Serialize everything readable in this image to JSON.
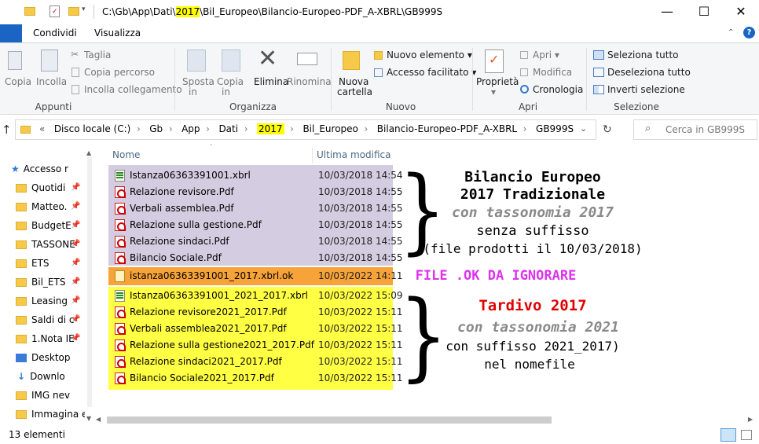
{
  "window": {
    "path_prefix": "C:\\Gb\\App\\Dati\\",
    "path_highlight": "2017",
    "path_suffix": "\\Bil_Europeo\\Bilancio-Europeo-PDF_A-XBRL\\GB999S",
    "minimize": "—",
    "maximize": "☐",
    "close": "✕"
  },
  "menu": {
    "tabs": [
      "Condividi",
      "Visualizza"
    ]
  },
  "ribbon": {
    "appunti": {
      "copia": "Copia",
      "incolla": "Incolla",
      "taglia": "Taglia",
      "copia_percorso": "Copia percorso",
      "incolla_collegamento": "Incolla collegamento",
      "group": "Appunti"
    },
    "organizza": {
      "sposta_1": "Sposta",
      "sposta_2": "in",
      "copia_1": "Copia",
      "copia_2": "in",
      "elimina": "Elimina",
      "rinomina": "Rinomina",
      "group": "Organizza"
    },
    "nuovo": {
      "nuova_1": "Nuova",
      "nuova_2": "cartella",
      "nuovo_elemento": "Nuovo elemento",
      "accesso_facilitato": "Accesso facilitato",
      "group": "Nuovo"
    },
    "apri": {
      "proprieta": "Proprietà",
      "apri": "Apri",
      "modifica": "Modifica",
      "cronologia": "Cronologia",
      "group": "Apri"
    },
    "selezione": {
      "seleziona_tutto": "Seleziona tutto",
      "deseleziona_tutto": "Deseleziona tutto",
      "inverti_selezione": "Inverti selezione",
      "group": "Selezione"
    }
  },
  "address": {
    "crumbs": [
      "Disco locale (C:)",
      "Gb",
      "App",
      "Dati",
      "2017",
      "Bil_Europeo",
      "Bilancio-Europeo-PDF_A-XBRL",
      "GB999S"
    ],
    "search_placeholder": "Cerca in GB999S"
  },
  "nav": {
    "items": [
      "Accesso r",
      "Quotidi",
      "Matteo.",
      "BudgetE",
      "TASSONE",
      "ETS",
      "Bil_ETS",
      "Leasing",
      "Saldi di c",
      "1.Nota IE",
      "Desktop",
      "Downlo",
      "IMG nev",
      "Immagina e"
    ]
  },
  "columns": {
    "name": "Nome",
    "modified": "Ultima modifica"
  },
  "files": [
    {
      "name": "Istanza06363391001.xbrl",
      "date": "10/03/2018 14:54",
      "type": "xbrl"
    },
    {
      "name": "Relazione revisore.Pdf",
      "date": "10/03/2018 14:55",
      "type": "pdf"
    },
    {
      "name": "Verbali assemblea.Pdf",
      "date": "10/03/2018 14:55",
      "type": "pdf"
    },
    {
      "name": "Relazione sulla gestione.Pdf",
      "date": "10/03/2018 14:55",
      "type": "pdf"
    },
    {
      "name": "Relazione sindaci.Pdf",
      "date": "10/03/2018 14:55",
      "type": "pdf"
    },
    {
      "name": "Bilancio Sociale.Pdf",
      "date": "10/03/2018 14:55",
      "type": "pdf"
    },
    {
      "name": "istanza06363391001_2017.xbrl.ok",
      "date": "10/03/2022 14:11",
      "type": "ok"
    },
    {
      "name": "Istanza06363391001_2021_2017.xbrl",
      "date": "10/03/2022 15:09",
      "type": "xbrl"
    },
    {
      "name": "Relazione revisore2021_2017.Pdf",
      "date": "10/03/2022 15:11",
      "type": "pdf"
    },
    {
      "name": "Verbali assemblea2021_2017.Pdf",
      "date": "10/03/2022 15:11",
      "type": "pdf"
    },
    {
      "name": "Relazione sulla gestione2021_2017.Pdf",
      "date": "10/03/2022 15:11",
      "type": "pdf"
    },
    {
      "name": "Relazione sindaci2021_2017.Pdf",
      "date": "10/03/2022 15:11",
      "type": "pdf"
    },
    {
      "name": "Bilancio Sociale2021_2017.Pdf",
      "date": "10/03/2022 15:11",
      "type": "pdf"
    }
  ],
  "annotations": {
    "a1": "Bilancio Europeo",
    "a2": "2017 Tradizionale",
    "a3": "con tassonomia 2017",
    "a4": "senza suffisso",
    "a5": "(file prodotti il 10/03/2018)",
    "ok": "FILE .OK DA IGNORARE",
    "b1": "Tardivo 2017",
    "b2": "con tassonomia 2021",
    "b3": "con suffisso 2021_2017)",
    "b4": "nel nomefile"
  },
  "colors": {
    "purple_highlight": "#d4cce0",
    "orange_highlight": "#f8a33a",
    "yellow_highlight": "#ffff44",
    "magenta_text": "#dd33ee",
    "red_text": "#e00000",
    "gray_text": "#8a8a8a"
  },
  "status": {
    "count": "13 elementi"
  }
}
